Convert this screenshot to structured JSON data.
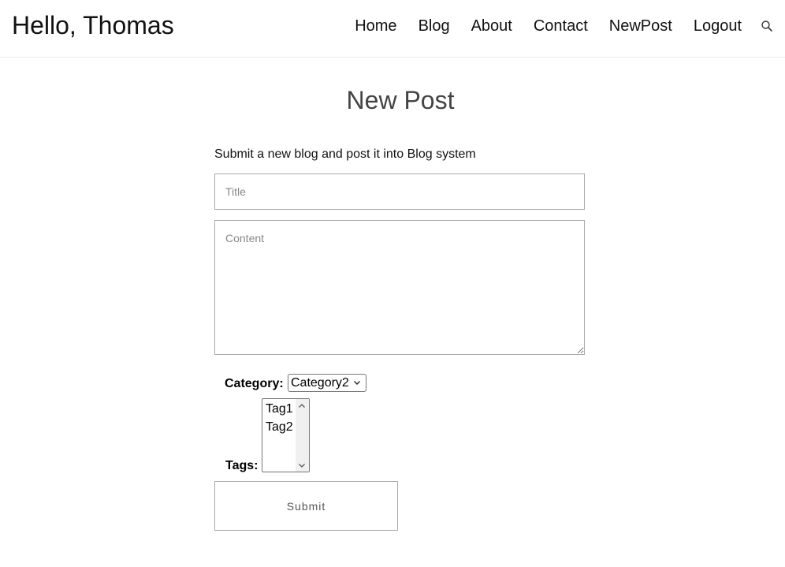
{
  "header": {
    "greeting": "Hello, Thomas",
    "nav": [
      "Home",
      "Blog",
      "About",
      "Contact",
      "NewPost",
      "Logout"
    ],
    "search_icon": "search-icon"
  },
  "page": {
    "heading": "New Post",
    "intro": "Submit a new blog and post it into Blog system"
  },
  "form": {
    "title_placeholder": "Title",
    "content_placeholder": "Content",
    "category_label": "Category:",
    "category_value": "Category2",
    "tags_label": "Tags:",
    "tags": [
      "Tag1",
      "Tag2"
    ],
    "submit_label": "Submit"
  }
}
